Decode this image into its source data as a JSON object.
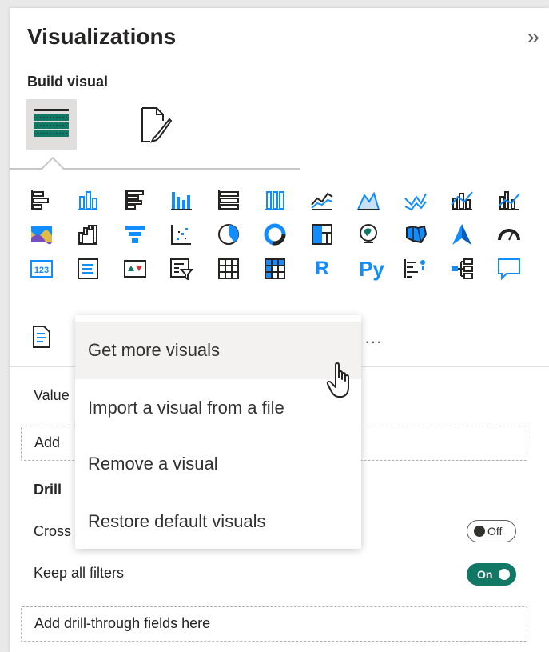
{
  "pane": {
    "title": "Visualizations",
    "collapse_glyph": "»",
    "build_visual": "Build visual",
    "tabs": [
      {
        "name": "build-visual-tab",
        "icon": "fields-grid-icon",
        "active": true
      },
      {
        "name": "format-visual-tab",
        "icon": "format-paintbrush-icon",
        "active": false
      }
    ]
  },
  "visuals": {
    "row1": [
      "stacked-bar-chart-icon",
      "stacked-column-chart-icon",
      "clustered-bar-chart-icon",
      "clustered-column-chart-icon",
      "100-stacked-bar-chart-icon",
      "100-stacked-column-chart-icon",
      "line-chart-icon",
      "area-chart-icon",
      "stacked-area-chart-icon",
      "line-and-stacked-column-chart-icon",
      "line-and-clustered-column-chart-icon"
    ],
    "row2": [
      "ribbon-chart-icon",
      "waterfall-chart-icon",
      "funnel-icon",
      "scatter-chart-icon",
      "pie-chart-icon",
      "donut-chart-icon",
      "treemap-icon",
      "map-icon",
      "filled-map-icon",
      "azure-map-icon",
      "gauge-icon"
    ],
    "row3": [
      "card-icon",
      "multi-row-card-icon",
      "kpi-icon",
      "slicer-icon",
      "table-icon",
      "matrix-icon",
      "r-script-visual-icon",
      "python-visual-icon",
      "key-influencers-icon",
      "decomposition-tree-icon",
      "qa-icon"
    ],
    "row4": [
      "paginated-report-icon"
    ],
    "r_label": "R",
    "py_label": "Py",
    "card_label": "123",
    "more_glyph": "···"
  },
  "fields": {
    "values_label": "Value",
    "add_data_label": "Add",
    "drill_label": "Drill",
    "cross_label": "Cross",
    "cross_toggle": "Off",
    "keep_filters_label": "Keep all filters",
    "keep_filters_toggle": "On",
    "drill_well": "Add drill-through fields here"
  },
  "menu": {
    "items": [
      {
        "label": "Get more visuals",
        "hover": true
      },
      {
        "label": "Import a visual from a file",
        "hover": false
      },
      {
        "label": "Remove a visual",
        "hover": false
      },
      {
        "label": "Restore default visuals",
        "hover": false
      }
    ]
  },
  "colors": {
    "accent_green": "#117865",
    "accent_blue": "#118dff",
    "text": "#252423"
  }
}
